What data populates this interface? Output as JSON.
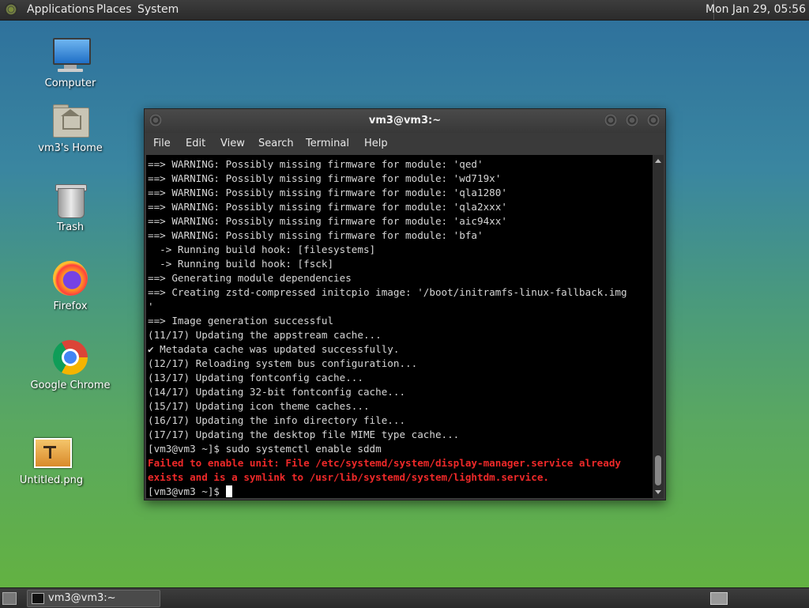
{
  "top_panel": {
    "menus": [
      "Applications",
      "Places",
      "System"
    ],
    "clock": "Mon Jan 29, 05:56"
  },
  "desktop_icons": {
    "computer": "Computer",
    "home": "vm3's Home",
    "trash": "Trash",
    "firefox": "Firefox",
    "chrome": "Google Chrome",
    "image": "Untitled.png"
  },
  "window": {
    "title": "vm3@vm3:~",
    "menu": [
      "File",
      "Edit",
      "View",
      "Search",
      "Terminal",
      "Help"
    ]
  },
  "terminal": {
    "lines": [
      "==> WARNING: Possibly missing firmware for module: 'qed'",
      "==> WARNING: Possibly missing firmware for module: 'wd719x'",
      "==> WARNING: Possibly missing firmware for module: 'qla1280'",
      "==> WARNING: Possibly missing firmware for module: 'qla2xxx'",
      "==> WARNING: Possibly missing firmware for module: 'aic94xx'",
      "==> WARNING: Possibly missing firmware for module: 'bfa'",
      "  -> Running build hook: [filesystems]",
      "  -> Running build hook: [fsck]",
      "==> Generating module dependencies",
      "==> Creating zstd-compressed initcpio image: '/boot/initramfs-linux-fallback.img",
      "'",
      "==> Image generation successful",
      "(11/17) Updating the appstream cache...",
      "✔ Metadata cache was updated successfully.",
      "(12/17) Reloading system bus configuration...",
      "(13/17) Updating fontconfig cache...",
      "(14/17) Updating 32-bit fontconfig cache...",
      "(15/17) Updating icon theme caches...",
      "(16/17) Updating the info directory file...",
      "(17/17) Updating the desktop file MIME type cache...",
      "[vm3@vm3 ~]$ sudo systemctl enable sddm"
    ],
    "error_line1": "Failed to enable unit: File /etc/systemd/system/display-manager.service already",
    "error_line2": "exists and is a symlink to /usr/lib/systemd/system/lightdm.service.",
    "prompt": "[vm3@vm3 ~]$ "
  },
  "bottom_panel": {
    "task_label": "vm3@vm3:~"
  }
}
